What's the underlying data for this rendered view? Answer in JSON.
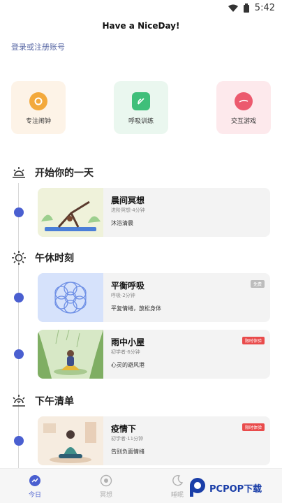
{
  "status_bar": {
    "time": "5:42"
  },
  "header": {
    "title": "Have a NiceDay!",
    "login_link": "登录或注册账号"
  },
  "quick_actions": [
    {
      "label": "专注闹钟",
      "icon": "alarm-icon",
      "color": "#f3a93c"
    },
    {
      "label": "呼吸训练",
      "icon": "leaf-icon",
      "color": "#3fbf7a"
    },
    {
      "label": "交互游戏",
      "icon": "ball-icon",
      "color": "#ec5a6e"
    }
  ],
  "sections": [
    {
      "title": "开始你的一天",
      "icon": "sunrise-icon"
    },
    {
      "title": "午休时刻",
      "icon": "sun-icon"
    },
    {
      "title": "下午清单",
      "icon": "sunset-icon"
    }
  ],
  "cards": [
    {
      "title": "晨间冥想",
      "subtitle": "进阶冥想·4分钟",
      "desc": "沐浴清晨",
      "badge": ""
    },
    {
      "title": "平衡呼吸",
      "subtitle": "呼吸·2分钟",
      "desc": "平复情绪，放松身体",
      "badge": "免费"
    },
    {
      "title": "雨中小屋",
      "subtitle": "初学者·6分钟",
      "desc": "心灵的避风港",
      "badge": "限时体验"
    },
    {
      "title": "疫情下",
      "subtitle": "初学者·11分钟",
      "desc": "告别负面情绪",
      "badge": "限时体验"
    }
  ],
  "tabbar": {
    "tabs": [
      {
        "label": "今日",
        "icon": "today-icon",
        "active": true
      },
      {
        "label": "冥想",
        "icon": "meditate-icon",
        "active": false
      },
      {
        "label": "睡眠",
        "icon": "moon-icon",
        "active": false
      }
    ]
  },
  "watermark": {
    "text": "PCPOP下载"
  },
  "colors": {
    "accent": "#4a5fd0",
    "badge_limited": "#e94b4b",
    "badge_free": "#bdbdbd"
  }
}
